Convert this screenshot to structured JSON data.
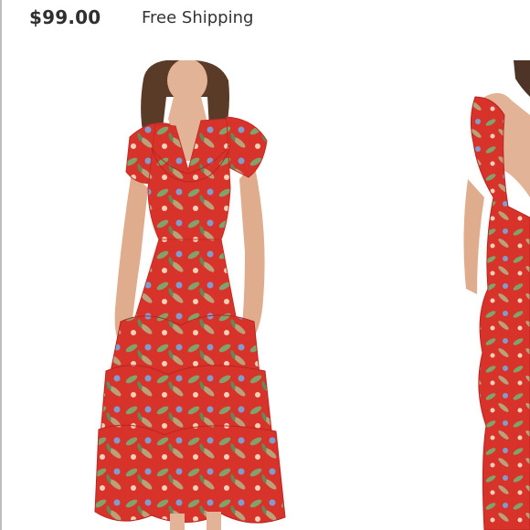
{
  "listing": {
    "price": "$99.00",
    "shipping": "Free Shipping"
  },
  "gallery": {
    "images": [
      {
        "view": "front",
        "subject": "red floral tiered ruffle midi dress"
      },
      {
        "view": "back",
        "subject": "red floral tiered ruffle midi dress"
      }
    ]
  },
  "colors": {
    "dress_red": "#d8332a",
    "text_dark": "#2f2f2f",
    "background": "#ffffff",
    "divider": "#bdbdbd"
  }
}
